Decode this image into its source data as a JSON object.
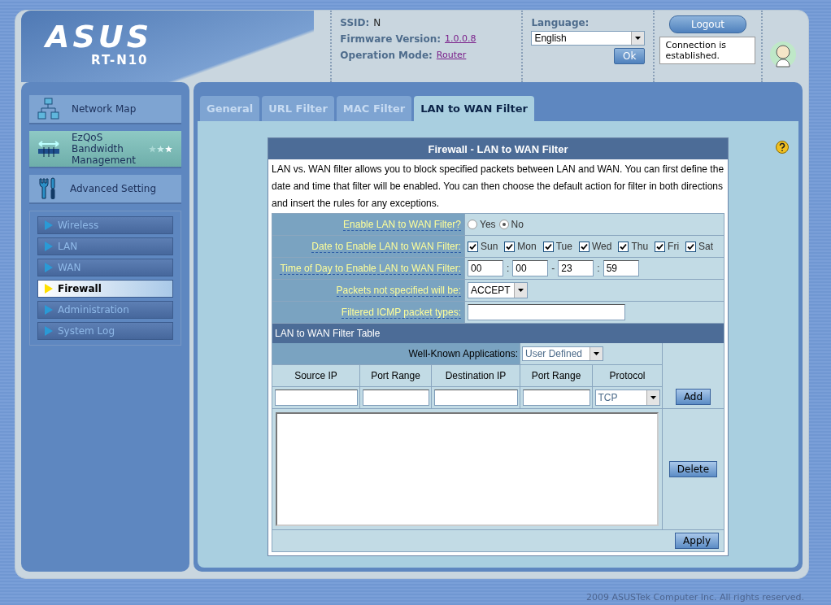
{
  "header": {
    "logo": "ASUS",
    "model": "RT-N10",
    "ssid_label": "SSID:",
    "ssid": "N",
    "firmware_label": "Firmware Version:",
    "firmware": "1.0.0.8",
    "mode_label": "Operation Mode:",
    "mode": "Router",
    "language_label": "Language:",
    "language": "English",
    "ok": "Ok",
    "logout": "Logout",
    "status": "Connection is established."
  },
  "sidebar": {
    "sections": [
      {
        "kind": "map",
        "label": "Network Map"
      },
      {
        "kind": "qos",
        "label": "EzQoS Bandwidth Management"
      },
      {
        "kind": "advanced",
        "label": "Advanced Setting"
      }
    ],
    "items": [
      {
        "label": "Wireless",
        "selected": false
      },
      {
        "label": "LAN",
        "selected": false
      },
      {
        "label": "WAN",
        "selected": false
      },
      {
        "label": "Firewall",
        "selected": true
      },
      {
        "label": "Administration",
        "selected": false
      },
      {
        "label": "System Log",
        "selected": false
      }
    ]
  },
  "tabs": [
    {
      "label": "General",
      "selected": false
    },
    {
      "label": "URL Filter",
      "selected": false
    },
    {
      "label": "MAC Filter",
      "selected": false
    },
    {
      "label": "LAN to WAN Filter",
      "selected": true
    }
  ],
  "panel": {
    "title": "Firewall - LAN to WAN Filter",
    "description": "LAN vs. WAN filter allows you to block specified packets between LAN and WAN. You can first define the date and time that filter will be enabled. You can then choose the default action for filter in both directions and insert the rules for any exceptions.",
    "fields": [
      {
        "kind": "radio",
        "label": "Enable LAN to WAN Filter?",
        "options": [
          {
            "label": "Yes",
            "selected": false
          },
          {
            "label": "No",
            "selected": true
          }
        ]
      },
      {
        "kind": "days",
        "label": "Date to Enable LAN to WAN Filter:",
        "days": [
          {
            "label": "Sun",
            "checked": true
          },
          {
            "label": "Mon",
            "checked": true
          },
          {
            "label": "Tue",
            "checked": true
          },
          {
            "label": "Wed",
            "checked": true
          },
          {
            "label": "Thu",
            "checked": true
          },
          {
            "label": "Fri",
            "checked": true
          },
          {
            "label": "Sat",
            "checked": true
          }
        ]
      },
      {
        "kind": "time",
        "label": "Time of Day to Enable LAN to WAN Filter:",
        "values": [
          "00",
          "00",
          "23",
          "59"
        ],
        "separators": [
          ":",
          "-",
          ":"
        ]
      },
      {
        "kind": "select",
        "label": "Packets not specified will be:",
        "value": "ACCEPT"
      },
      {
        "kind": "text",
        "label": "Filtered ICMP packet types:"
      }
    ],
    "table": {
      "title": "LAN to WAN Filter Table",
      "app_label": "Well-Known Applications:",
      "app_value": "User Defined",
      "columns": [
        "Source IP",
        "Port Range",
        "Destination IP",
        "Port Range",
        "Protocol"
      ],
      "protocol": "TCP",
      "add": "Add",
      "delete": "Delete",
      "apply": "Apply"
    }
  },
  "footer": "2009 ASUSTek Computer Inc. All rights reserved."
}
